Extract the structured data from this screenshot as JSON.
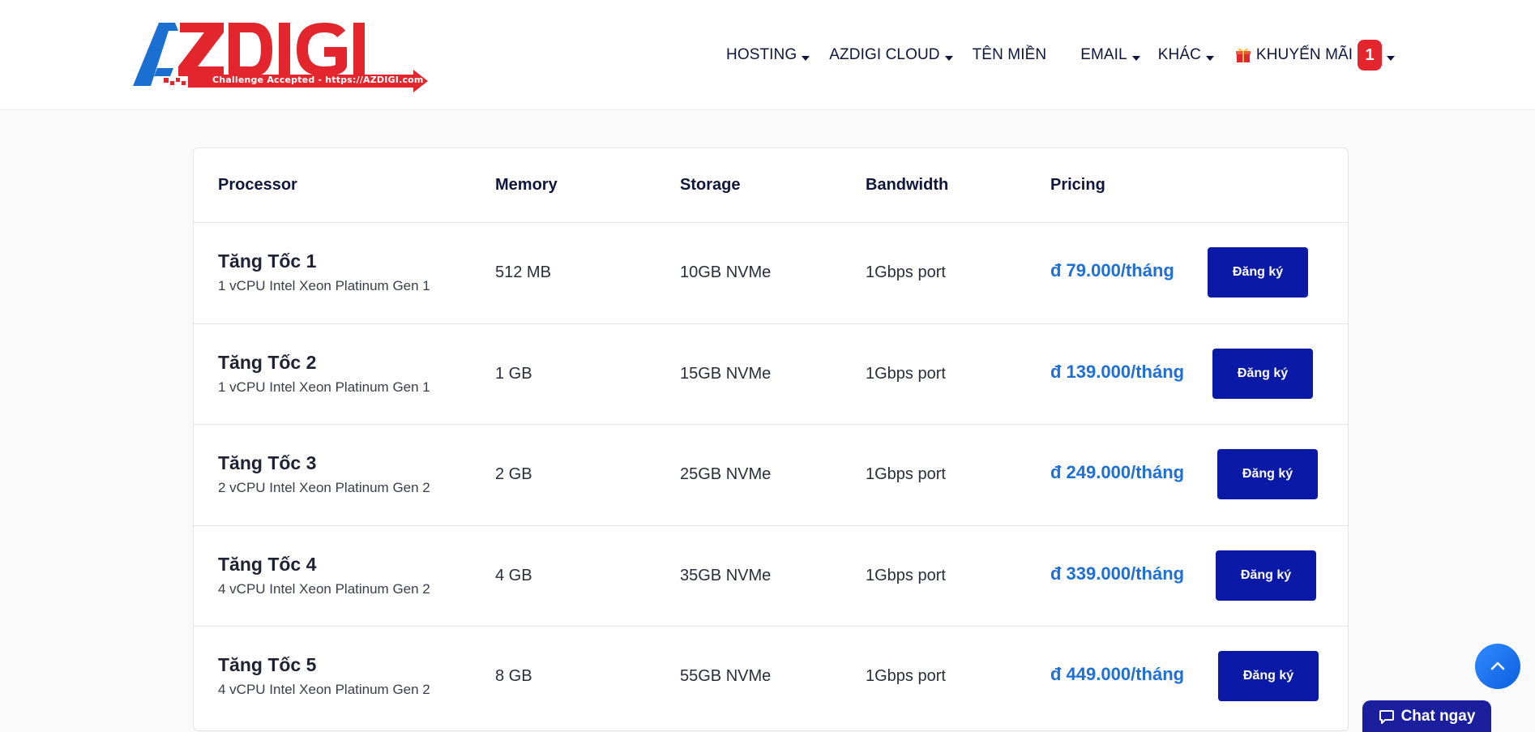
{
  "brand": {
    "logo_text": "AZDIGI",
    "tagline": "Challenge Accepted - https://AZDIGI.com",
    "colors": {
      "blue": "#1b6fd0",
      "red": "#e3262d",
      "navy": "#10163a"
    }
  },
  "nav": {
    "hosting": "HOSTING",
    "cloud": "AZDIGI CLOUD",
    "domain": "TÊN MIỀN",
    "email": "EMAIL",
    "other": "KHÁC",
    "promo": "KHUYẾN MÃI",
    "promo_count": "1"
  },
  "table": {
    "headers": {
      "processor": "Processor",
      "memory": "Memory",
      "storage": "Storage",
      "bandwidth": "Bandwidth",
      "pricing": "Pricing"
    },
    "rows": [
      {
        "name": "Tăng Tốc 1",
        "cpu": "1 vCPU Intel Xeon Platinum Gen 1",
        "memory": "512 MB",
        "storage": "10GB NVMe",
        "bandwidth": "1Gbps port",
        "price": "đ 79.000/tháng",
        "button": "Đăng ký"
      },
      {
        "name": "Tăng Tốc 2",
        "cpu": "1 vCPU Intel Xeon Platinum Gen 1",
        "memory": "1 GB",
        "storage": "15GB NVMe",
        "bandwidth": "1Gbps port",
        "price": "đ 139.000/tháng",
        "button": "Đăng ký"
      },
      {
        "name": "Tăng Tốc 3",
        "cpu": "2 vCPU Intel Xeon Platinum Gen 2",
        "memory": "2 GB",
        "storage": "25GB NVMe",
        "bandwidth": "1Gbps port",
        "price": "đ 249.000/tháng",
        "button": "Đăng ký"
      },
      {
        "name": "Tăng Tốc 4",
        "cpu": "4 vCPU Intel Xeon Platinum Gen 2",
        "memory": "4 GB",
        "storage": "35GB NVMe",
        "bandwidth": "1Gbps port",
        "price": "đ 339.000/tháng",
        "button": "Đăng ký"
      },
      {
        "name": "Tăng Tốc 5",
        "cpu": "4 vCPU Intel Xeon Platinum Gen 2",
        "memory": "8 GB",
        "storage": "55GB NVMe",
        "bandwidth": "1Gbps port",
        "price": "đ 449.000/tháng",
        "button": "Đăng ký"
      }
    ]
  },
  "icons": {
    "caret": "chevron-down-icon",
    "gift": "gift-icon",
    "scroll_top": "arrow-up-icon",
    "chat": "chat-bubble-icon"
  },
  "chat": {
    "label": "Chat ngay"
  }
}
